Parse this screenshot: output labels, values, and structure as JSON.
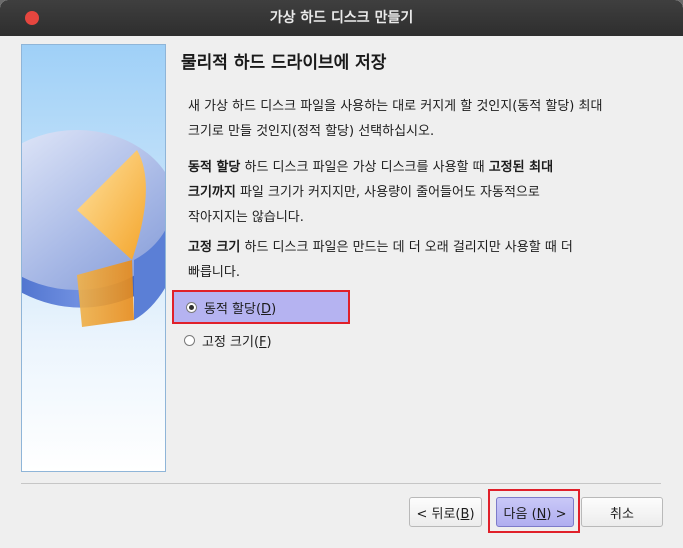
{
  "window": {
    "title": "가상 하드 디스크 만들기"
  },
  "page": {
    "heading": "물리적 하드 드라이브에 저장",
    "intro_line1": "새 가상 하드 디스크 파일을 사용하는 대로 커지게 할 것인지(동적 할당) 최대",
    "intro_line2": "크기로 만들 것인지(정적 할당) 선택하십시오.",
    "dynamic_desc_bold": "동적 할당",
    "dynamic_desc_text1": " 하드 디스크 파일은 가상 디스크를 사용할 때 ",
    "dynamic_desc_bold2": "고정된 최대",
    "dynamic_desc_bold3": "크기까지",
    "dynamic_desc_text2": " 파일 크기가 커지지만, 사용량이 줄어들어도 자동적으로",
    "dynamic_desc_text3": "작아지지는 않습니다.",
    "fixed_desc_bold": "고정 크기",
    "fixed_desc_text1": " 하드 디스크 파일은 만드는 데 더 오래 걸리지만 사용할 때 더",
    "fixed_desc_text2": "빠릅니다."
  },
  "options": {
    "dynamic": {
      "label": "동적 할당(",
      "mnemonic": "D",
      "suffix": ")",
      "checked": true
    },
    "fixed": {
      "label": "고정 크기(",
      "mnemonic": "F",
      "suffix": ")",
      "checked": false
    }
  },
  "buttons": {
    "back": {
      "prefix": "< 뒤로(",
      "mnemonic": "B",
      "suffix": ")"
    },
    "next": {
      "prefix": "다음 (",
      "mnemonic": "N",
      "suffix": ") >"
    },
    "cancel": {
      "label": "취소"
    }
  },
  "colors": {
    "accent_selection": "#b5b3f1",
    "highlight_border": "#e0202a",
    "close_button": "#e6463f"
  }
}
